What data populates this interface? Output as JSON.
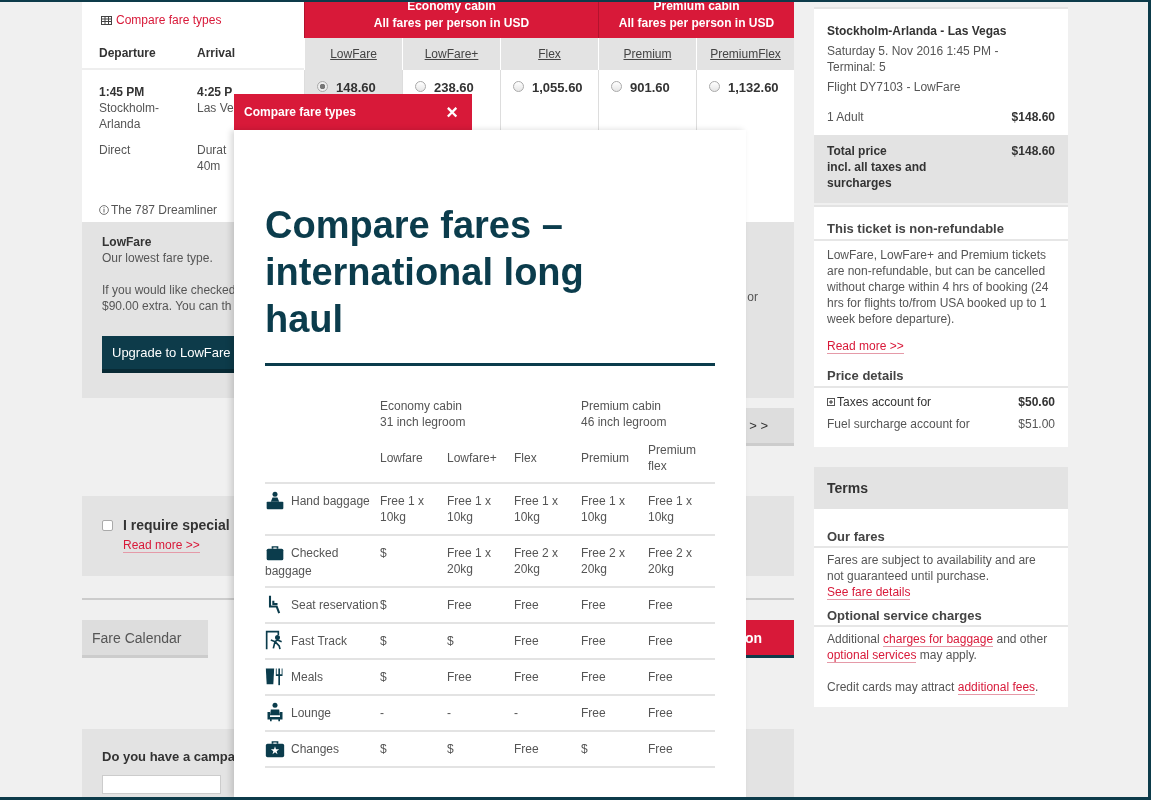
{
  "compare_link": "Compare fare types",
  "flight_columns": [
    "Departure",
    "Arrival"
  ],
  "cabins": [
    {
      "title": "Economy cabin",
      "subtitle": "All fares per person in USD"
    },
    {
      "title": "Premium cabin",
      "subtitle": "All fares per person in USD"
    }
  ],
  "fares": [
    {
      "label": "LowFare",
      "price": "148.60",
      "selected": true
    },
    {
      "label": "LowFare+",
      "price": "238.60",
      "selected": false
    },
    {
      "label": "Flex",
      "price": "1,055.60",
      "selected": false
    },
    {
      "label": "Premium",
      "price": "901.60",
      "selected": false
    },
    {
      "label": "PremiumFlex",
      "price": "1,132.60",
      "selected": false
    }
  ],
  "flight": {
    "departure_time": "1:45 PM",
    "departure_airport": "Stockholm-Arlanda",
    "stops": "Direct",
    "arrival_time": "4:25 P",
    "arrival_airport": "Las Ve",
    "duration": "Durat",
    "duration_rest": "40m",
    "aircraft": "The 787 Dreamliner"
  },
  "fare_info": {
    "title": "LowFare",
    "subtitle": "Our lowest fare type.",
    "lines": [
      "If you would like checked",
      "$90.00 extra. You can th"
    ],
    "right_text": "or",
    "button": "Upgrade to LowFare"
  },
  "next_button": "> >",
  "special": {
    "checked": false,
    "label": "I require special",
    "link": "Read more >>"
  },
  "fare_calendar_button": "Fare Calendar",
  "continue_button": "on",
  "campaign": {
    "label": "Do you have a campa"
  },
  "summary": {
    "route": "Stockholm-Arlanda - Las Vegas",
    "date": "Saturday 5. Nov 2016 1:45 PM - Terminal: 5",
    "flight": "Flight DY7103 - LowFare",
    "passengers": "1 Adult",
    "passengers_price": "$148.60",
    "total_lines": [
      "Total price",
      "incl. all taxes and",
      "surcharges"
    ],
    "total_price": "$148.60"
  },
  "refund": {
    "title": "This ticket is non-refundable",
    "text": "LowFare, LowFare+ and Premium tickets are non-refundable, but can be cancelled without charge within 4 hrs of booking (24 hrs for flights to/from USA booked up to 1 week before departure).",
    "link": "Read more >>"
  },
  "price_details": {
    "title": "Price details",
    "rows": [
      {
        "label": "Taxes account for",
        "value": "$50.60",
        "expandable": true
      },
      {
        "label": "Fuel surcharge account for",
        "value": "$51.00",
        "expandable": false
      }
    ]
  },
  "terms": {
    "title": "Terms",
    "sections": [
      {
        "heading": "Our fares",
        "paragraphs": [
          [
            {
              "kind": "text",
              "text": "Fares are subject to availability and are not guaranteed until purchase."
            }
          ],
          [
            {
              "kind": "link",
              "text": "See fare details"
            }
          ]
        ]
      },
      {
        "heading": "Optional service charges",
        "paragraphs": [
          [
            {
              "kind": "text",
              "text": "Additional "
            },
            {
              "kind": "link",
              "text": "charges for baggage"
            },
            {
              "kind": "text",
              "text": " and other "
            },
            {
              "kind": "link",
              "text": "optional services"
            },
            {
              "kind": "text",
              "text": " may apply."
            }
          ],
          [
            {
              "kind": "text",
              "text": "Credit cards may attract "
            },
            {
              "kind": "link",
              "text": "additional fees"
            },
            {
              "kind": "text",
              "text": "."
            }
          ]
        ]
      }
    ]
  },
  "modal": {
    "header": "Compare fare types",
    "close": "×",
    "title": "Compare fares – international long haul",
    "cabins": [
      {
        "name": "Economy cabin",
        "legroom": "31 inch legroom",
        "fares": [
          "Lowfare",
          "Lowfare+",
          "Flex"
        ]
      },
      {
        "name": "Premium cabin",
        "legroom": "46 inch legroom",
        "fares": [
          "Premium",
          "Premium flex"
        ]
      }
    ],
    "rows": [
      {
        "label": "Hand baggage",
        "values": [
          "Free 1 x 10kg",
          "Free 1 x 10kg",
          "Free 1 x 10kg",
          "Free 1 x 10kg",
          "Free 1 x 10kg"
        ]
      },
      {
        "label": "Checked baggage",
        "values": [
          "$",
          "Free 1 x 20kg",
          "Free 2 x 20kg",
          "Free 2 x 20kg",
          "Free 2 x 20kg"
        ]
      },
      {
        "label": "Seat reservation",
        "values": [
          "$",
          "Free",
          "Free",
          "Free",
          "Free"
        ]
      },
      {
        "label": "Fast Track",
        "values": [
          "$",
          "$",
          "Free",
          "Free",
          "Free"
        ]
      },
      {
        "label": "Meals",
        "values": [
          "$",
          "Free",
          "Free",
          "Free",
          "Free"
        ]
      },
      {
        "label": "Lounge",
        "values": [
          "-",
          "-",
          "-",
          "Free",
          "Free"
        ]
      },
      {
        "label": "Changes",
        "values": [
          "$",
          "$",
          "Free",
          "$",
          "Free"
        ]
      }
    ]
  }
}
